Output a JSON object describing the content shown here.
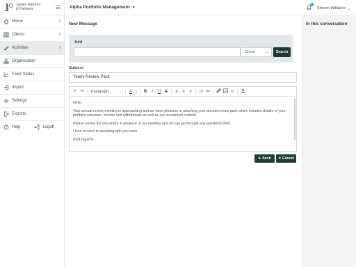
{
  "brand": {
    "line1": "James Hambro",
    "line2": "& Partners"
  },
  "nav": [
    {
      "label": "Home",
      "icon": "home-icon",
      "chevron": true
    },
    {
      "label": "Clients",
      "icon": "clients-icon",
      "chevron": true
    },
    {
      "label": "Activities",
      "icon": "activities-icon",
      "chevron": true,
      "active": true
    },
    {
      "label": "Organisation",
      "icon": "organisation-icon",
      "chevron": false
    },
    {
      "label": "Feed Status",
      "icon": "feed-status-icon",
      "chevron": false
    },
    {
      "label": "Import",
      "icon": "import-icon",
      "chevron": false
    },
    {
      "label": "Settings",
      "icon": "gear-icon",
      "chevron": false
    },
    {
      "label": "Exports",
      "icon": "exports-icon",
      "chevron": false
    }
  ],
  "footer": {
    "help": "Help",
    "logoff": "Logoff"
  },
  "topbar": {
    "title": "Alpha Portfolio Management",
    "notification_count": "5",
    "user_name": "Steven Williams"
  },
  "main": {
    "section_title": "New Message",
    "add": {
      "label": "Add",
      "input_value": "",
      "select_value": "Client",
      "search_label": "Search"
    },
    "subject": {
      "label": "Subject",
      "value": "Yearly Review Pack"
    },
    "editor": {
      "paragraph_style": "Paragraph",
      "body": [
        "Hello,",
        "Your annual review meeting is approaching and we have pleasure in attaching your annual review pack which includes details of your portfolio valuation, income and withdrawals as well as our investment outlook.",
        "Please review the document in advance of our meeting and we can go through any questions then.",
        "I look forward to speaking with you soon.",
        "Kind regards,"
      ]
    },
    "send_label": "Send",
    "cancel_label": "Cancel"
  },
  "right_panel": {
    "title": "In this conversation"
  },
  "colors": {
    "accent_dark": "#1f3a38",
    "badge": "#1e88c8",
    "panel_grey": "#e3e6ea"
  }
}
